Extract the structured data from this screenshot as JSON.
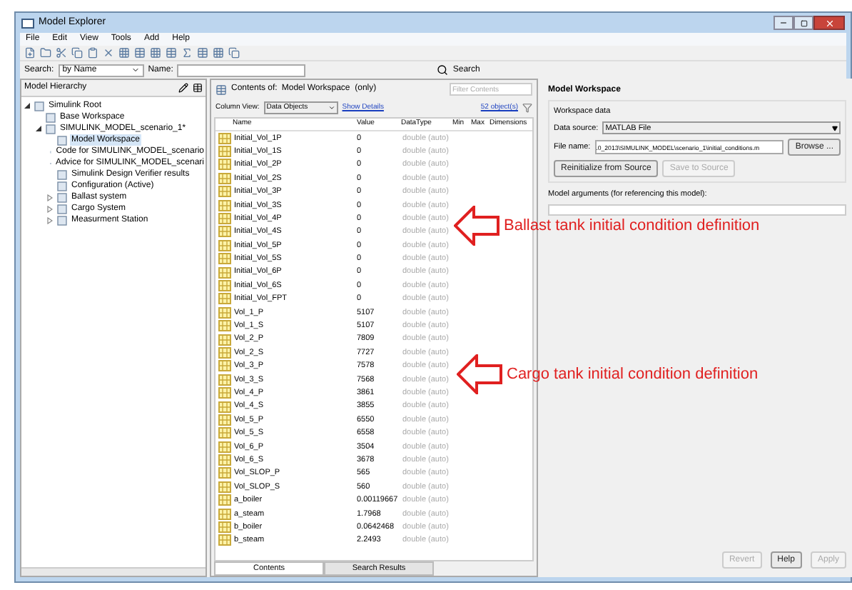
{
  "window": {
    "title": "Model Explorer"
  },
  "menu": [
    "File",
    "Edit",
    "View",
    "Tools",
    "Add",
    "Help"
  ],
  "search_bar": {
    "label": "Search:",
    "mode": "by Name",
    "name_label": "Name:",
    "button": "Search"
  },
  "hierarchy": {
    "title": "Model Hierarchy",
    "tree": [
      {
        "label": "Simulink Root",
        "expanded": true,
        "selected": false,
        "children": [
          {
            "label": "Base Workspace",
            "selected": false
          },
          {
            "label": "SIMULINK_MODEL_scenario_1*",
            "expanded": true,
            "selected": false,
            "children": [
              {
                "label": "Model Workspace",
                "selected": true
              },
              {
                "label": "Code for SIMULINK_MODEL_scenario",
                "selected": false
              },
              {
                "label": "Advice for SIMULINK_MODEL_scenari",
                "selected": false
              },
              {
                "label": "Simulink Design Verifier results",
                "selected": false
              },
              {
                "label": "Configuration (Active)",
                "selected": false
              },
              {
                "label": "Ballast system",
                "expanded": false,
                "selected": false
              },
              {
                "label": "Cargo System",
                "expanded": false,
                "selected": false
              },
              {
                "label": "Measurment Station",
                "expanded": false,
                "selected": false
              }
            ]
          }
        ]
      }
    ]
  },
  "contents": {
    "label": "Contents of:",
    "scope": "Model Workspace  (only)",
    "filter_placeholder": "Filter Contents",
    "column_view_label": "Column View:",
    "column_view": "Data Objects",
    "details_link": "Show Details",
    "count": "52 object(s)",
    "columns": [
      "Name",
      "Value",
      "DataType",
      "Min",
      "Max",
      "Dimensions"
    ],
    "rows": [
      {
        "name": "Initial_Vol_1P",
        "value": "0",
        "datatype": "double (auto)"
      },
      {
        "name": "Initial_Vol_1S",
        "value": "0",
        "datatype": "double (auto)"
      },
      {
        "name": "Initial_Vol_2P",
        "value": "0",
        "datatype": "double (auto)"
      },
      {
        "name": "Initial_Vol_2S",
        "value": "0",
        "datatype": "double (auto)"
      },
      {
        "name": "Initial_Vol_3P",
        "value": "0",
        "datatype": "double (auto)"
      },
      {
        "name": "Initial_Vol_3S",
        "value": "0",
        "datatype": "double (auto)"
      },
      {
        "name": "Initial_Vol_4P",
        "value": "0",
        "datatype": "double (auto)"
      },
      {
        "name": "Initial_Vol_4S",
        "value": "0",
        "datatype": "double (auto)"
      },
      {
        "name": "Initial_Vol_5P",
        "value": "0",
        "datatype": "double (auto)"
      },
      {
        "name": "Initial_Vol_5S",
        "value": "0",
        "datatype": "double (auto)"
      },
      {
        "name": "Initial_Vol_6P",
        "value": "0",
        "datatype": "double (auto)"
      },
      {
        "name": "Initial_Vol_6S",
        "value": "0",
        "datatype": "double (auto)"
      },
      {
        "name": "Initial_Vol_FPT",
        "value": "0",
        "datatype": "double (auto)"
      },
      {
        "name": "Vol_1_P",
        "value": "5107",
        "datatype": "double (auto)"
      },
      {
        "name": "Vol_1_S",
        "value": "5107",
        "datatype": "double (auto)"
      },
      {
        "name": "Vol_2_P",
        "value": "7809",
        "datatype": "double (auto)"
      },
      {
        "name": "Vol_2_S",
        "value": "7727",
        "datatype": "double (auto)"
      },
      {
        "name": "Vol_3_P",
        "value": "7578",
        "datatype": "double (auto)"
      },
      {
        "name": "Vol_3_S",
        "value": "7568",
        "datatype": "double (auto)"
      },
      {
        "name": "Vol_4_P",
        "value": "3861",
        "datatype": "double (auto)"
      },
      {
        "name": "Vol_4_S",
        "value": "3855",
        "datatype": "double (auto)"
      },
      {
        "name": "Vol_5_P",
        "value": "6550",
        "datatype": "double (auto)"
      },
      {
        "name": "Vol_5_S",
        "value": "6558",
        "datatype": "double (auto)"
      },
      {
        "name": "Vol_6_P",
        "value": "3504",
        "datatype": "double (auto)"
      },
      {
        "name": "Vol_6_S",
        "value": "3678",
        "datatype": "double (auto)"
      },
      {
        "name": "Vol_SLOP_P",
        "value": "565",
        "datatype": "double (auto)"
      },
      {
        "name": "Vol_SLOP_S",
        "value": "560",
        "datatype": "double (auto)"
      },
      {
        "name": "a_boiler",
        "value": "0.00119667",
        "datatype": "double (auto)"
      },
      {
        "name": "a_steam",
        "value": "1.7968",
        "datatype": "double (auto)"
      },
      {
        "name": "b_boiler",
        "value": "0.0642468",
        "datatype": "double (auto)"
      },
      {
        "name": "b_steam",
        "value": "2.2493",
        "datatype": "double (auto)"
      }
    ],
    "tabs": [
      {
        "label": "Contents",
        "selected": true
      },
      {
        "label": "Search Results",
        "selected": false
      }
    ]
  },
  "workspace": {
    "title": "Model Workspace",
    "group": "Workspace data",
    "source_label": "Data source:",
    "source": "MATLAB File",
    "file_label": "File name:",
    "file": ".0_2013\\SIMULINK_MODEL\\scenario_1\\initial_conditions.m",
    "browse": "Browse ...",
    "reinit": "Reinitialize from Source",
    "save": "Save to Source",
    "save_disabled": true,
    "args_label": "Model arguments (for referencing this model):"
  },
  "annotations": [
    {
      "text": "Ballast tank initial condition definition"
    },
    {
      "text": "Cargo tank initial condition definition"
    }
  ],
  "buttons": [
    {
      "label": "Revert",
      "disabled": true
    },
    {
      "label": "Help",
      "disabled": false
    },
    {
      "label": "Apply",
      "disabled": true
    }
  ]
}
